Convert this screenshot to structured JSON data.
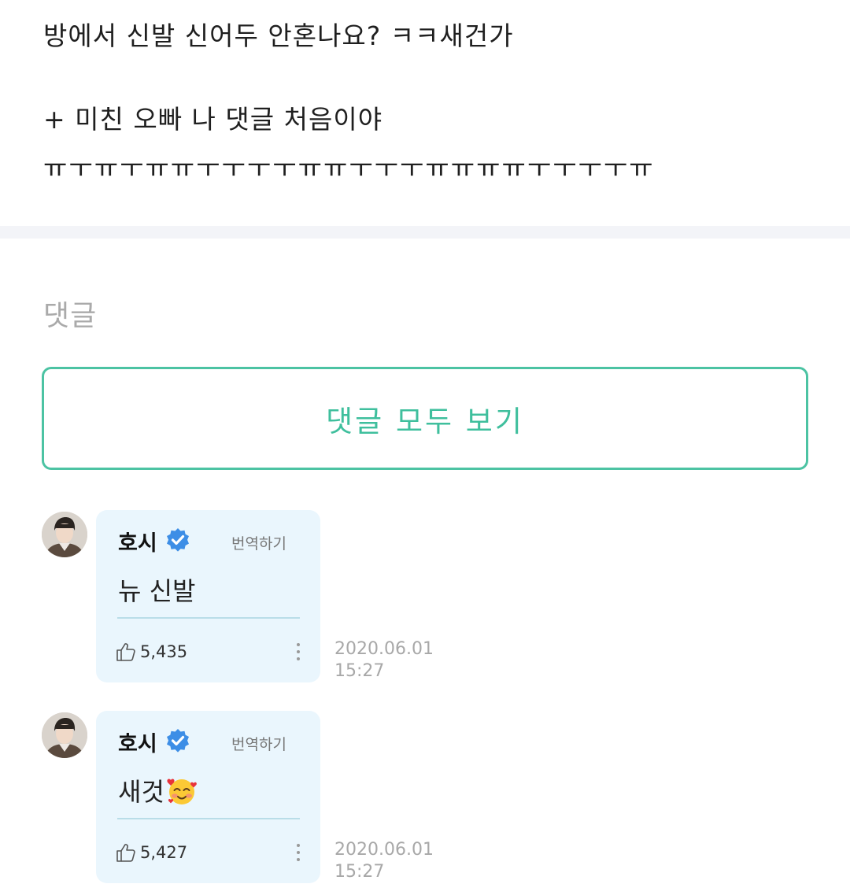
{
  "post": {
    "lines": [
      "방에서 신발 신어두 안혼나요? ㅋㅋ새건가",
      "+ 미친 오빠 나 댓글 처음이야",
      "ㅠㅜㅠㅜㅠㅠㅜㅜㅜㅜㅠㅠㅜㅜㅜㅠㅠㅠㅠㅜㅜㅜㅜㅠ"
    ]
  },
  "comments_section": {
    "title": "댓글",
    "view_all_label": "댓글 모두 보기"
  },
  "comments": [
    {
      "author": "호시",
      "translate_label": "번역하기",
      "text": "뉴 신발",
      "likes": "5,435",
      "date": "2020.06.01",
      "time": "15:27"
    },
    {
      "author": "호시",
      "translate_label": "번역하기",
      "text": "새것",
      "emoji": "smiling-face-with-hearts",
      "likes": "5,427",
      "date": "2020.06.01",
      "time": "15:27"
    }
  ],
  "icons": {
    "verified": "verified-badge-icon",
    "like": "thumbs-up-icon",
    "more": "more-vertical-icon"
  },
  "colors": {
    "accent": "#3fbf9d",
    "verified": "#3d8ee6",
    "bubble_bg": "#eaf6fd",
    "divider": "#f3f4f8",
    "muted_text": "#a8a8a8"
  }
}
